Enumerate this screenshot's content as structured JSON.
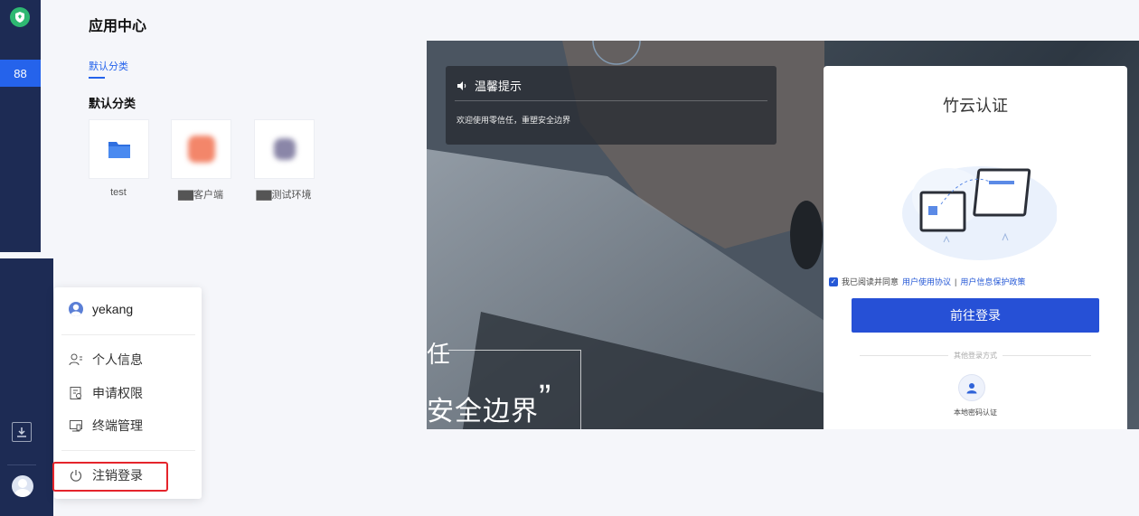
{
  "sidebar": {
    "logo_icon": "shield-logo-icon",
    "apps_icon": "apps-grid-icon",
    "apps_glyph": "88",
    "download_icon": "download-icon",
    "avatar_icon": "user-avatar-icon"
  },
  "main": {
    "title": "应用中心",
    "tab_label": "默认分类",
    "section_title": "默认分类",
    "apps": [
      {
        "label": "test",
        "icon": "folder-icon"
      },
      {
        "label": "▇▇客户端",
        "icon": "blurred-app-icon"
      },
      {
        "label": "▇▇测试环境",
        "icon": "blurred-app-icon"
      }
    ]
  },
  "user_menu": {
    "username": "yekang",
    "items": [
      {
        "label": "个人信息",
        "icon": "user-info-icon"
      },
      {
        "label": "申请权限",
        "icon": "permission-icon"
      },
      {
        "label": "终端管理",
        "icon": "terminal-icon"
      }
    ],
    "logout_label": "注销登录",
    "logout_icon": "power-icon",
    "highlight_color": "#e5242b"
  },
  "login_preview": {
    "notice": {
      "title": "温馨提示",
      "icon": "speaker-icon",
      "body": "欢迎使用零信任，重塑安全边界"
    },
    "slogan_partial": "任",
    "slogan_main": "安全边界",
    "slogan_quote": "”",
    "card": {
      "title": "竹云认证",
      "agree_text": "我已阅读并同意",
      "agree_link1": "用户使用协议",
      "agree_sep": "|",
      "agree_link2": "用户信息保护政策",
      "login_button": "前往登录",
      "other_methods": "其他登录方式",
      "local_method": "本地密码认证",
      "local_icon": "user-icon"
    },
    "accent_color": "#2650d6"
  }
}
